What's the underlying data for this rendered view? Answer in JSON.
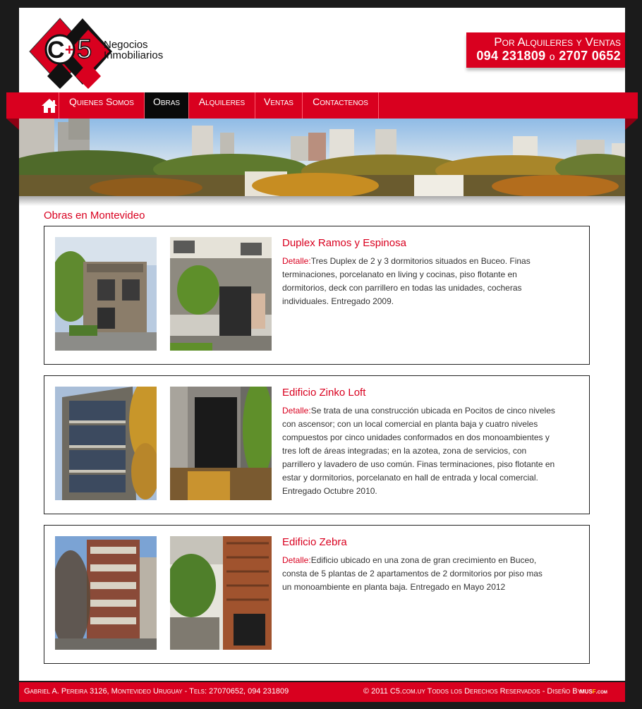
{
  "header": {
    "logo_main": "C5",
    "logo_line1": "Negocios",
    "logo_line2": "Inmobiliarios",
    "phone_title": "Por Alquileres y Ventas",
    "phone_a": "094 231809",
    "phone_or": "o",
    "phone_b": "2707 0652"
  },
  "nav": {
    "home_icon": "home-icon",
    "items": [
      {
        "label": "Quienes Somos"
      },
      {
        "label": "Obras"
      },
      {
        "label": "Alquileres"
      },
      {
        "label": "Ventas"
      },
      {
        "label": "Contactenos"
      }
    ],
    "active": "Obras"
  },
  "main": {
    "section_title": "Obras en Montevideo",
    "detail_label": "Detalle:",
    "projects": [
      {
        "title": "Duplex Ramos y Espinosa",
        "detail": "Tres Duplex de 2 y 3 dormitorios situados en Buceo. Finas terminaciones, porcelanato en living y cocinas, piso flotante en dormitorios, deck con parrillero en todas las unidades, cocheras individuales. Entregado 2009."
      },
      {
        "title": "Edificio Zinko Loft",
        "detail": "Se trata de una construcción ubicada en Pocitos de cinco niveles con ascensor; con un local comercial en planta baja y cuatro niveles compuestos por cinco unidades conformados en dos monoambientes y tres loft de áreas integradas; en la azotea, zona de servicios, con parrillero y lavadero de uso común. Finas terminaciones, piso flotante en estar y dormitorios, porcelanato en hall de entrada y local comercial. Entregado Octubre 2010."
      },
      {
        "title": "Edificio Zebra",
        "detail": "Edificio ubicado en una zona de gran crecimiento en Buceo, consta de 5 plantas de 2 apartamentos de 2 dormitorios por piso mas un monoambiente en planta baja. Entregado en Mayo 2012"
      }
    ]
  },
  "footer": {
    "address": "Gabriel A. Pereira 3126, Montevideo Uruguay - Tels: 27070652, 094 231809",
    "copyright": "© 2011 C5.com.uy Todos los Derechos Reservados - Diseño By",
    "brand_a": "mus",
    "brand_b": "f",
    "brand_c": ".com"
  },
  "colors": {
    "brand_red": "#d9001f",
    "background": "#1b1b1b",
    "nav_active": "#0a0a0a"
  }
}
